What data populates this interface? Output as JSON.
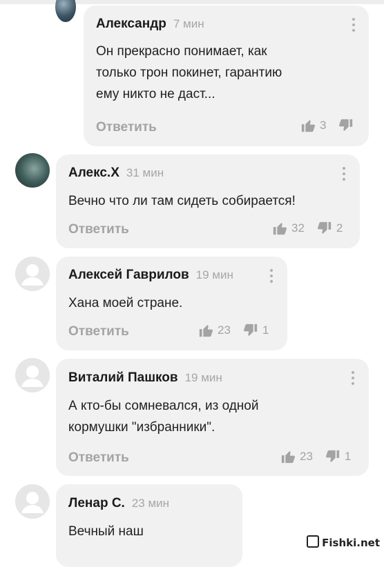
{
  "comments": [
    {
      "author": "Александр",
      "time": "7 мин",
      "text": "Он прекрасно понимает, как\nтолько трон покинет, гарантию\nему никто не даст...",
      "reply": "Ответить",
      "likes": "3",
      "dislikes": ""
    },
    {
      "author": "Алекс.Х",
      "time": "31 мин",
      "text": "Вечно что ли там сидеть собирается!",
      "reply": "Ответить",
      "likes": "32",
      "dislikes": "2"
    },
    {
      "author": "Алексей Гаврилов",
      "time": "19 мин",
      "text": "Хана моей стране.",
      "reply": "Ответить",
      "likes": "23",
      "dislikes": "1"
    },
    {
      "author": "Виталий Пашков",
      "time": "19 мин",
      "text": "А кто-бы сомневался, из одной\nкормушки \"избранники\".",
      "reply": "Ответить",
      "likes": "23",
      "dislikes": "1"
    },
    {
      "author": "Ленар С.",
      "time": "23 мин",
      "text": "Вечный наш",
      "reply": "",
      "likes": "",
      "dislikes": ""
    }
  ],
  "watermark": "Fishki.net",
  "icons": [
    "thumb-up-icon",
    "thumb-down-icon",
    "more-vertical-icon",
    "default-avatar-icon"
  ]
}
